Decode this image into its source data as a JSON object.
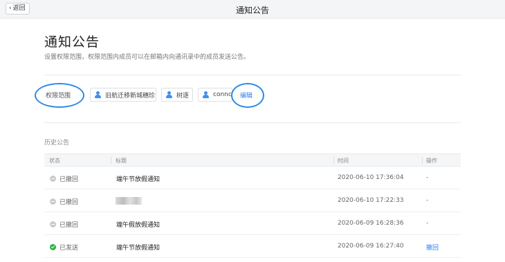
{
  "topbar": {
    "back_label": "返回",
    "title": "通知公告"
  },
  "header": {
    "title": "通知公告",
    "description": "设置权限范围，权限范围内成员可以在邮箱内向通讯录中的成员发送公告。"
  },
  "permissions": {
    "label": "权限范围",
    "members": [
      "旧航迁移新城穗珍",
      "树逐",
      "connc"
    ],
    "edit_label": "编辑"
  },
  "history": {
    "title": "历史公告",
    "columns": {
      "status": "状态",
      "subject": "标题",
      "time": "时间",
      "action": "操作"
    },
    "rows": [
      {
        "status": "已撤回",
        "subject": "端午节放假通知",
        "time": "2020-06-10 17:36:04",
        "action": "-"
      },
      {
        "status": "已撤回",
        "subject": "",
        "time": "2020-06-10 17:22:33",
        "action": "-"
      },
      {
        "status": "已撤回",
        "subject": "端午假放假通知",
        "time": "2020-06-09 16:28:36",
        "action": "-"
      },
      {
        "status": "已发送",
        "subject": "端午节放假通知",
        "time": "2020-06-09 16:27:40",
        "action": "撤回"
      }
    ]
  },
  "colors": {
    "accent": "#2c7ef0",
    "annotation_circle": "#2b8ae8",
    "sent_green": "#27b148",
    "recalled_gray": "#c8cbd0"
  }
}
